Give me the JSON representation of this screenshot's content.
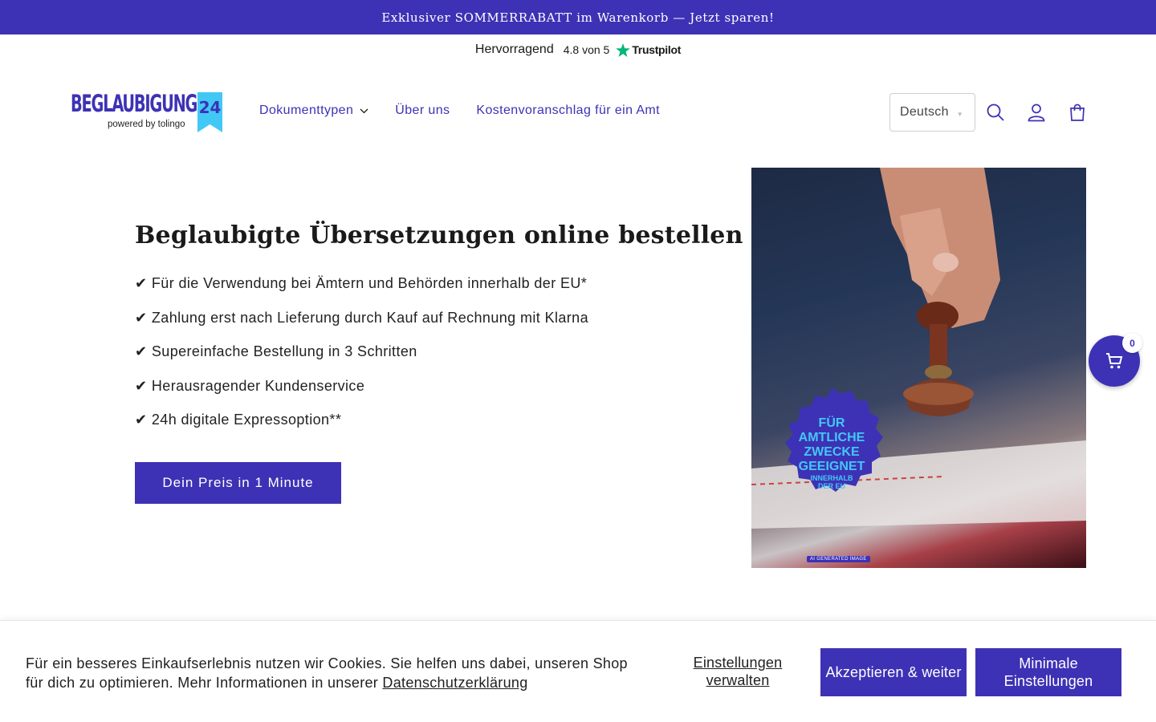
{
  "announcement": "Exklusiver SOMMERRABATT im Warenkorb — Jetzt sparen!",
  "trustpilot": {
    "label": "Hervorragend",
    "score": "4.8 von 5",
    "brand": "Trustpilot",
    "star_color": "#00b67a"
  },
  "logo": {
    "main": "BEGLAUBIGUNG",
    "badge": "24",
    "sub": "powered by tolingo"
  },
  "nav": {
    "items": [
      {
        "label": "Dokumenttypen",
        "has_dropdown": true
      },
      {
        "label": "Über uns"
      },
      {
        "label": "Kostenvoranschlag für ein Amt"
      }
    ]
  },
  "language": {
    "selected": "Deutsch"
  },
  "header_icons": [
    "search-icon",
    "account-icon",
    "cart-icon"
  ],
  "hero": {
    "title": "Beglaubigte Übersetzungen online bestellen",
    "features": [
      "✔ Für die Verwendung bei Ämtern und Behörden innerhalb der EU*",
      "✔ Zahlung erst nach Lieferung durch Kauf auf Rechnung mit Klarna",
      "✔ Supereinfache Bestellung in 3 Schritten",
      "✔ Herausragender Kundenservice",
      "✔ 24h digitale Expressoption**"
    ],
    "cta": "Dein Preis in 1 Minute"
  },
  "hero_image": {
    "badge_line1": "FÜR",
    "badge_line2": "AMTLICHE",
    "badge_line3": "ZWECKE",
    "badge_line4": "GEEIGNET",
    "badge_small1": "INNERHALB",
    "badge_small2": "DER EU",
    "ai_tag": "AI GENERATED IMAGE"
  },
  "cart": {
    "count": "0"
  },
  "cookie": {
    "text": "Für ein besseres Einkaufserlebnis nutzen wir Cookies. Sie helfen uns dabei, unseren Shop für dich zu optimieren. Mehr Informationen in unserer",
    "link": "Datenschutzerklärung",
    "manage": "Einstellungen verwalten",
    "accept": "Akzeptieren & weiter",
    "minimal": "Minimale Einstellungen"
  },
  "colors": {
    "brand": "#3d32b5",
    "badge_blue": "#42c8f5"
  }
}
